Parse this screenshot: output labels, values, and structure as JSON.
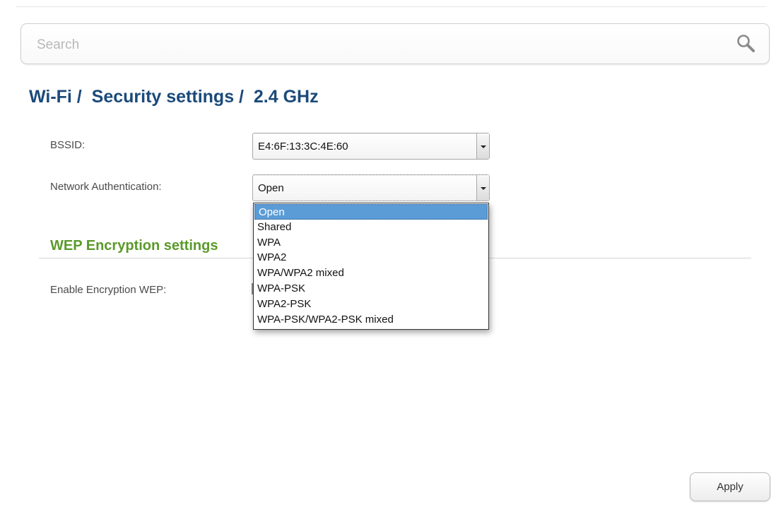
{
  "search": {
    "placeholder": "Search",
    "icon": "search-icon"
  },
  "breadcrumb": {
    "text": "Wi-Fi /  Security settings /  2.4 GHz"
  },
  "form": {
    "bssid_label": "BSSID:",
    "bssid_value": "E4:6F:13:3C:4E:60",
    "auth_label": "Network Authentication:",
    "auth_value": "Open",
    "auth_options": [
      "Open",
      "Shared",
      "WPA",
      "WPA2",
      "WPA/WPA2 mixed",
      "WPA-PSK",
      "WPA2-PSK",
      "WPA-PSK/WPA2-PSK mixed"
    ],
    "auth_selected_index": 0
  },
  "wep": {
    "section_title": "WEP Encryption settings",
    "enable_label": "Enable Encryption WEP:"
  },
  "actions": {
    "apply_label": "Apply"
  },
  "colors": {
    "title": "#1b4a7a",
    "section_title": "#5b9a2a",
    "selected_option": "#5b9bd6"
  }
}
